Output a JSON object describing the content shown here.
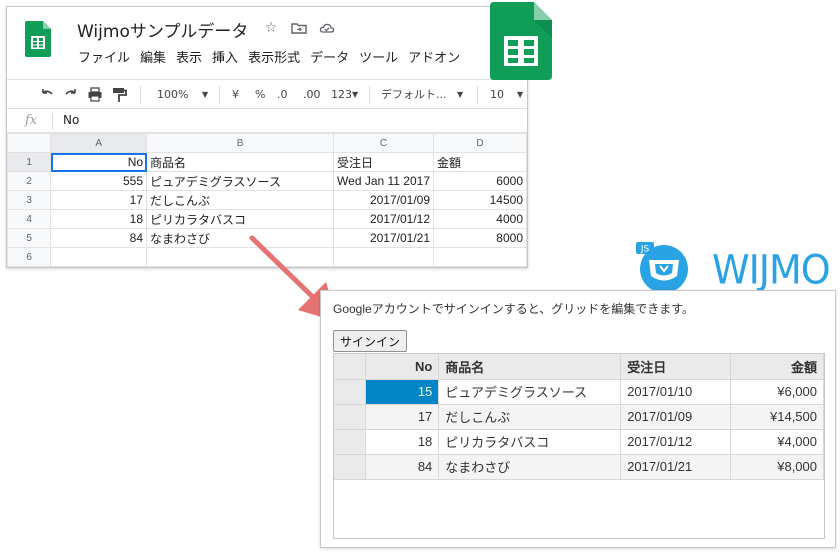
{
  "sheets": {
    "doc_title": "Wijmoサンプルデータ",
    "menu": [
      "ファイル",
      "編集",
      "表示",
      "挿入",
      "表示形式",
      "データ",
      "ツール",
      "アドオン"
    ],
    "toolbar": {
      "zoom": "100%",
      "currency": "¥",
      "percent": "%",
      "decrease_decimals": ".0",
      "increase_decimals": ".00",
      "more_formats": "123",
      "font": "デフォルト...",
      "font_size": "10"
    },
    "formula_bar": {
      "fx": "fx",
      "value": "No"
    },
    "columns": [
      "A",
      "B",
      "C",
      "D"
    ],
    "row_numbers": [
      "1",
      "2",
      "3",
      "4",
      "5",
      "6"
    ],
    "rows": [
      [
        "No",
        "商品名",
        "受注日",
        "金額"
      ],
      [
        "555",
        "ピュアデミグラスソース",
        "Wed Jan 11 2017",
        "6000"
      ],
      [
        "17",
        "だしこんぶ",
        "2017/01/09",
        "14500"
      ],
      [
        "18",
        "ピリカラタバスコ",
        "2017/01/12",
        "4000"
      ],
      [
        "84",
        "なまわさび",
        "2017/01/21",
        "8000"
      ],
      [
        "",
        "",
        "",
        ""
      ]
    ]
  },
  "wijmo": {
    "logo_badge": "JS",
    "wordmark": "WIJMO",
    "message": "Googleアカウントでサインインすると、グリッドを編集できます。",
    "signin_label": "サインイン",
    "headers": [
      "No",
      "商品名",
      "受注日",
      "金額"
    ],
    "rows": [
      [
        "15",
        "ピュアデミグラスソース",
        "2017/01/10",
        "¥6,000"
      ],
      [
        "17",
        "だしこんぶ",
        "2017/01/09",
        "¥14,500"
      ],
      [
        "18",
        "ピリカラタバスコ",
        "2017/01/12",
        "¥4,000"
      ],
      [
        "84",
        "なまわさび",
        "2017/01/21",
        "¥8,000"
      ]
    ]
  },
  "colors": {
    "sheets_green": "#0f9d58",
    "selection_blue": "#1a73e8",
    "arrow": "#e57373",
    "wijmo_blue": "#2aa3e5",
    "wijmo_selected": "#0085c7"
  }
}
